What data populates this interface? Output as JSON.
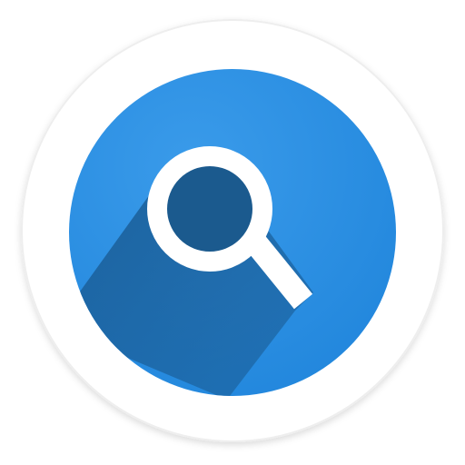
{
  "app_icon": {
    "name": "search-app-icon",
    "icon": "magnifying-glass-icon",
    "colors": {
      "plate": "#ffffff",
      "plate_border": "#eeeeee",
      "circle": "#2a8ee3",
      "circle_highlight": "#3a9bea",
      "long_shadow": "#1a5e98",
      "lens_fill": "#1b5a8e",
      "glass_stroke": "#ffffff"
    }
  }
}
